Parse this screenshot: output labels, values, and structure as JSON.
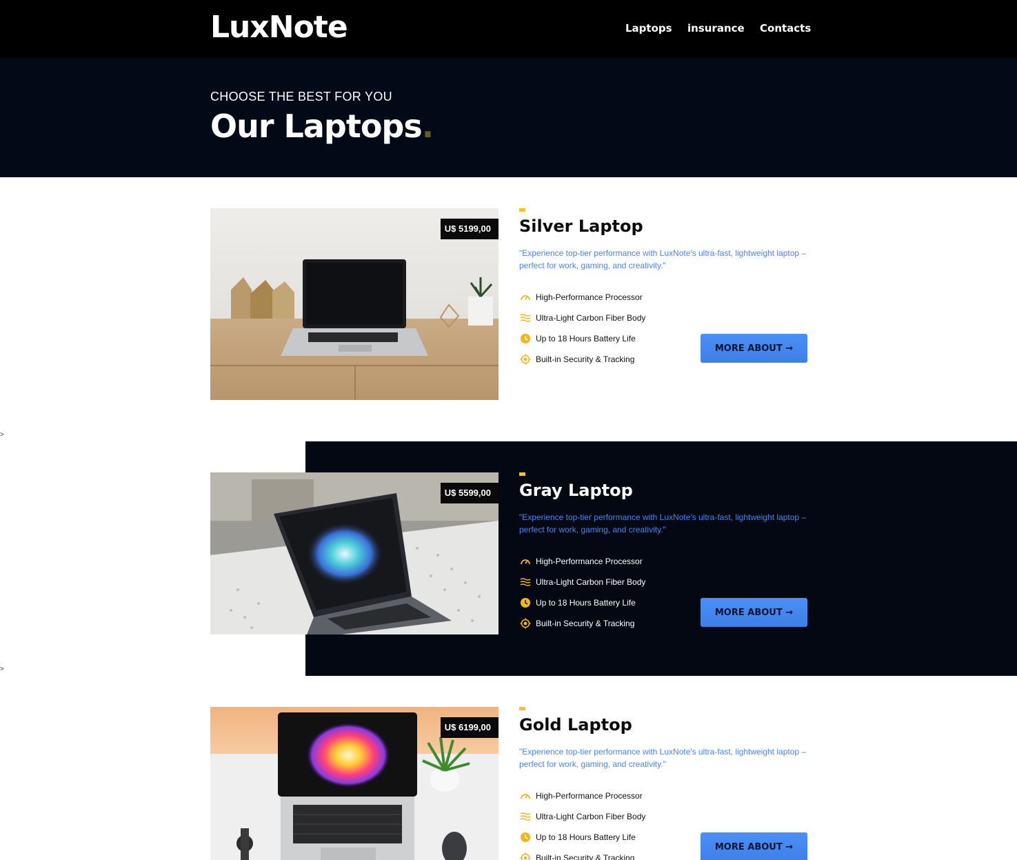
{
  "header": {
    "logo": "LuxNote",
    "nav": [
      {
        "label": "Laptops"
      },
      {
        "label": "insurance"
      },
      {
        "label": "Contacts"
      }
    ]
  },
  "hero": {
    "subtitle": "CHOOSE THE BEST FOR YOU",
    "title": "Our Laptops",
    "title_dot": "."
  },
  "stray_markers": [
    ">",
    ">"
  ],
  "products": [
    {
      "name": "Silver Laptop",
      "price": "U$ 5199,00",
      "description": "\"Experience top-tier performance with LuxNote's ultra-fast, lightweight laptop – perfect for work, gaming, and creativity.\"",
      "features": [
        {
          "icon": "speedometer-icon",
          "label": "High-Performance Processor"
        },
        {
          "icon": "waves-icon",
          "label": "Ultra-Light Carbon Fiber Body"
        },
        {
          "icon": "clock-icon",
          "label": "Up to 18 Hours Battery Life"
        },
        {
          "icon": "target-icon",
          "label": "Built-in Security & Tracking"
        }
      ],
      "button": "MORE ABOUT →",
      "image": "silver-laptop-on-desk-photo"
    },
    {
      "name": "Gray Laptop",
      "price": "U$ 5599,00",
      "description": "\"Experience top-tier performance with LuxNote's ultra-fast, lightweight laptop – perfect for work, gaming, and creativity.\"",
      "features": [
        {
          "icon": "speedometer-icon",
          "label": "High-Performance Processor"
        },
        {
          "icon": "waves-icon",
          "label": "Ultra-Light Carbon Fiber Body"
        },
        {
          "icon": "clock-icon",
          "label": "Up to 18 Hours Battery Life"
        },
        {
          "icon": "target-icon",
          "label": "Built-in Security & Tracking"
        }
      ],
      "button": "MORE ABOUT →",
      "image": "gray-laptop-color-splash-photo"
    },
    {
      "name": "Gold Laptop",
      "price": "U$ 6199,00",
      "description": "\"Experience top-tier performance with LuxNote's ultra-fast, lightweight laptop – perfect for work, gaming, and creativity.\"",
      "features": [
        {
          "icon": "speedometer-icon",
          "label": "High-Performance Processor"
        },
        {
          "icon": "waves-icon",
          "label": "Ultra-Light Carbon Fiber Body"
        },
        {
          "icon": "clock-icon",
          "label": "Up to 18 Hours Battery Life"
        },
        {
          "icon": "target-icon",
          "label": "Built-in Security & Tracking"
        }
      ],
      "button": "MORE ABOUT →",
      "image": "gold-laptop-top-view-photo"
    }
  ],
  "colors": {
    "accent_yellow": "#f5c518",
    "button_blue": "#4a8af0",
    "description_blue": "#4a86e8",
    "dark_band": "#030812",
    "hero_bg": "#020a17"
  }
}
